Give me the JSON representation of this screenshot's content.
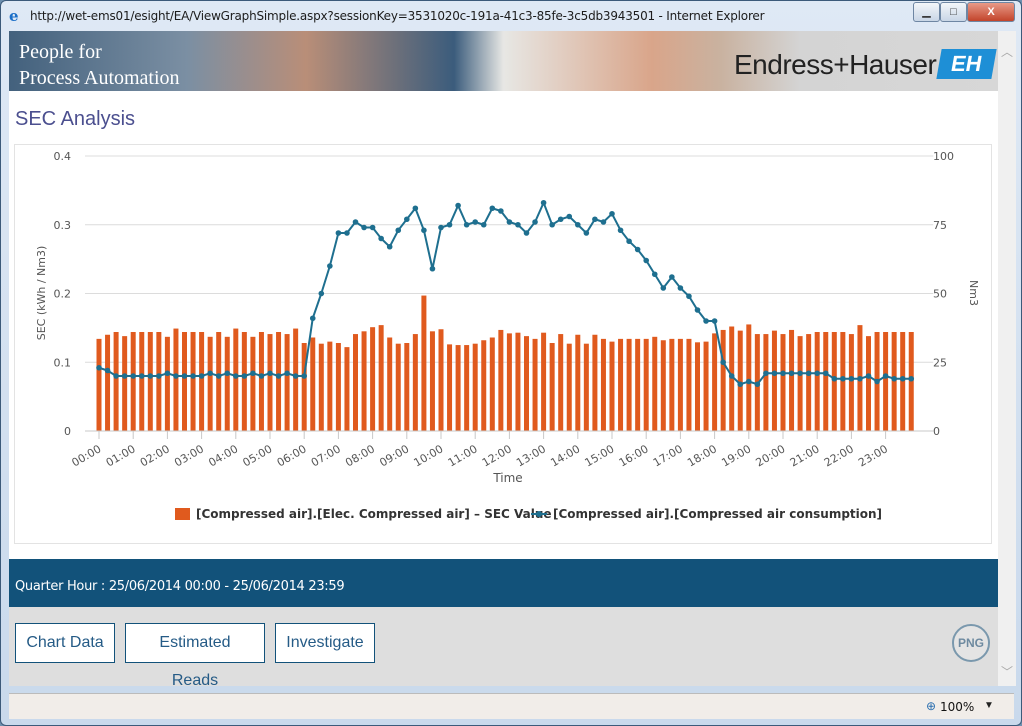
{
  "window": {
    "title": "http://wet-ems01/esight/EA/ViewGraphSimple.aspx?sessionKey=3531020c-191a-41c3-85fe-3c5db3943501 - Internet Explorer",
    "minimize": "▁",
    "maximize": "□",
    "close": "X"
  },
  "banner": {
    "tagline_line1": "People for",
    "tagline_line2": "Process Automation",
    "brand": "Endress+Hauser",
    "logo": "EH"
  },
  "page": {
    "title": "SEC Analysis"
  },
  "info": {
    "period": "Quarter Hour : 25/06/2014 00:00 - 25/06/2014 23:59"
  },
  "actions": {
    "chart_data": "Chart Data",
    "estimated_reads": "Estimated Reads",
    "investigate": "Investigate",
    "png": "PNG"
  },
  "statusbar": {
    "zoom": "100%"
  },
  "colors": {
    "bar": "#e05a1e",
    "line": "#1e6f8f",
    "header_band": "#12527a",
    "title": "#4b4f8f"
  },
  "chart_data": {
    "type": "bar+line",
    "title": "",
    "xlabel": "Time",
    "ylabel_left": "SEC (kWh / Nm3)",
    "ylabel_right": "Nm3",
    "ylim_left": [
      0,
      0.4
    ],
    "ylim_right": [
      0,
      100
    ],
    "yticks_left": [
      "0",
      "0.1",
      "0.2",
      "0.3",
      "0.4"
    ],
    "yticks_right": [
      "0",
      "25",
      "50",
      "75",
      "100"
    ],
    "xticks": [
      "00:00",
      "01:00",
      "02:00",
      "03:00",
      "04:00",
      "05:00",
      "06:00",
      "07:00",
      "08:00",
      "09:00",
      "10:00",
      "11:00",
      "12:00",
      "13:00",
      "14:00",
      "15:00",
      "16:00",
      "17:00",
      "18:00",
      "19:00",
      "20:00",
      "21:00",
      "22:00",
      "23:00"
    ],
    "interval": "15 min",
    "grid": true,
    "legend_position": "bottom",
    "series": [
      {
        "name": "[Compressed air].[Elec. Compressed air] - SEC Value",
        "type": "bar",
        "axis": "left",
        "values": [
          0.134,
          0.14,
          0.144,
          0.138,
          0.144,
          0.144,
          0.144,
          0.144,
          0.137,
          0.149,
          0.144,
          0.144,
          0.144,
          0.137,
          0.144,
          0.137,
          0.149,
          0.144,
          0.137,
          0.144,
          0.141,
          0.144,
          0.141,
          0.149,
          0.128,
          0.136,
          0.127,
          0.13,
          0.128,
          0.122,
          0.141,
          0.145,
          0.151,
          0.154,
          0.136,
          0.127,
          0.128,
          0.141,
          0.197,
          0.145,
          0.148,
          0.126,
          0.125,
          0.125,
          0.127,
          0.132,
          0.136,
          0.147,
          0.142,
          0.143,
          0.138,
          0.134,
          0.143,
          0.128,
          0.141,
          0.127,
          0.14,
          0.127,
          0.14,
          0.134,
          0.13,
          0.134,
          0.134,
          0.134,
          0.134,
          0.137,
          0.132,
          0.134,
          0.134,
          0.134,
          0.129,
          0.13,
          0.142,
          0.147,
          0.152,
          0.146,
          0.155,
          0.141,
          0.141,
          0.146,
          0.141,
          0.147,
          0.138,
          0.141,
          0.144,
          0.144,
          0.144,
          0.144,
          0.141,
          0.154,
          0.138,
          0.144,
          0.144,
          0.144,
          0.144,
          0.144
        ]
      },
      {
        "name": "[Compressed air].[Compressed air consumption]",
        "type": "line",
        "axis": "right",
        "values": [
          23,
          22,
          20,
          20,
          20,
          20,
          20,
          20,
          21,
          20,
          20,
          20,
          20,
          21,
          20,
          21,
          20,
          20,
          21,
          20,
          21,
          20,
          21,
          20,
          20,
          41,
          50,
          60,
          72,
          72,
          76,
          74,
          74,
          70,
          67,
          73,
          77,
          81,
          73,
          59,
          74,
          75,
          82,
          75,
          76,
          75,
          81,
          80,
          76,
          75,
          72,
          76,
          83,
          75,
          77,
          78,
          75,
          72,
          77,
          76,
          79,
          73,
          69,
          66,
          62,
          57,
          52,
          56,
          52,
          49,
          44,
          40,
          40,
          25,
          20,
          17,
          18,
          17,
          21,
          21,
          21,
          21,
          21,
          21,
          21,
          21,
          19,
          19,
          19,
          19,
          20,
          18,
          20,
          19,
          19,
          19
        ]
      }
    ]
  }
}
